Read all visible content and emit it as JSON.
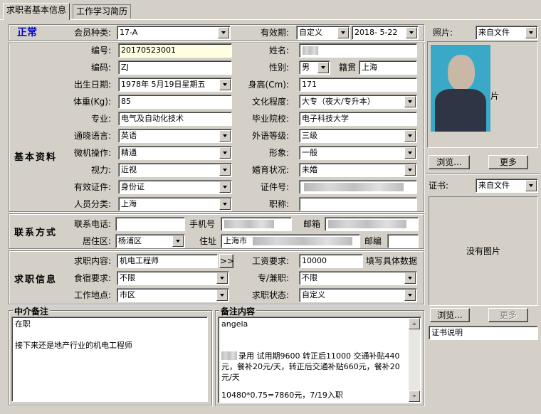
{
  "tabs": [
    "求职者基本信息",
    "工作学习简历"
  ],
  "status": "正常",
  "sections": {
    "basic": "基本资料",
    "contact": "联系方式",
    "job": "求职信息",
    "agency_notes": "中介备注",
    "notes": "备注内容"
  },
  "form": {
    "member_type": {
      "label": "会员种类:",
      "value": "17-A"
    },
    "valid_period": {
      "label": "有效期:",
      "value": "自定义",
      "date": "2018- 5-22"
    },
    "number": {
      "label": "编号:",
      "value": "20170523001"
    },
    "name": {
      "label": "姓名:"
    },
    "code": {
      "label": "编码:",
      "value": "ZJ"
    },
    "gender": {
      "label": "性别:",
      "value": "男"
    },
    "hometown": {
      "label": "籍贯",
      "value": "上海"
    },
    "birth": {
      "label": "出生日期:",
      "value": "1978年 5月19日星期五"
    },
    "height": {
      "label": "身高(Cm):",
      "value": "171"
    },
    "weight": {
      "label": "体重(Kg):",
      "value": "85"
    },
    "education": {
      "label": "文化程度:",
      "value": "大专（夜大/专升本）"
    },
    "major": {
      "label": "专业:",
      "value": "电气及自动化技术"
    },
    "school": {
      "label": "毕业院校:",
      "value": "电子科技大学"
    },
    "language": {
      "label": "通晓语言:",
      "value": "英语"
    },
    "lang_level": {
      "label": "外语等级:",
      "value": "三级"
    },
    "computer": {
      "label": "微机操作:",
      "value": "精通"
    },
    "appearance": {
      "label": "形象:",
      "value": "一般"
    },
    "vision": {
      "label": "视力:",
      "value": "近视"
    },
    "marital": {
      "label": "婚育状况:",
      "value": "未婚"
    },
    "id_type": {
      "label": "有效证件:",
      "value": "身份证"
    },
    "id_number": {
      "label": "证件号:"
    },
    "staff_type": {
      "label": "人员分类:",
      "value": "上海"
    },
    "title": {
      "label": "职称:"
    }
  },
  "contact": {
    "phone_label": "联系电话:",
    "mobile_label": "手机号",
    "email_label": "邮箱",
    "district_label": "居住区:",
    "district_value": "杨浦区",
    "address_label": "住址",
    "address_value": "上海市",
    "zip_label": "邮编"
  },
  "job": {
    "position_label": "求职内容:",
    "position_value": "机电工程师",
    "more_button": ">>",
    "salary_label": "工资要求:",
    "salary_value": "10000",
    "salary_hint": "填写具体数据",
    "lodging_label": "食宿要求:",
    "lodging_value": "不限",
    "parttime_label": "专/兼职:",
    "parttime_value": "不限",
    "location_label": "工作地点:",
    "location_value": "市区",
    "state_label": "求职状态:",
    "state_value": "自定义"
  },
  "agency_notes": [
    "在职",
    "",
    "接下来还是地产行业的机电工程师"
  ],
  "notes": {
    "line1": "angela",
    "line2": "录用  试用期9600  转正后11000  交通补贴440元，餐补20元/天，转正后交通补贴660元，餐补20元/天",
    "line3": "10480*0.75=7860元，7/19入职"
  },
  "photo_panel": {
    "label": "照片:",
    "source": "来自文件",
    "photo_caption": "片",
    "browse": "浏览...",
    "more": "更多"
  },
  "cert_panel": {
    "label": "证书:",
    "source": "来自文件",
    "empty_text": "没有图片",
    "browse": "浏览...",
    "more": "更多",
    "desc_value": "证书说明"
  },
  "colors": {
    "window_bg": "#d4d0c8",
    "status_blue": "#0000cc",
    "field_highlight": "#ffffe1",
    "photo_bg": "#3aa9c8"
  }
}
